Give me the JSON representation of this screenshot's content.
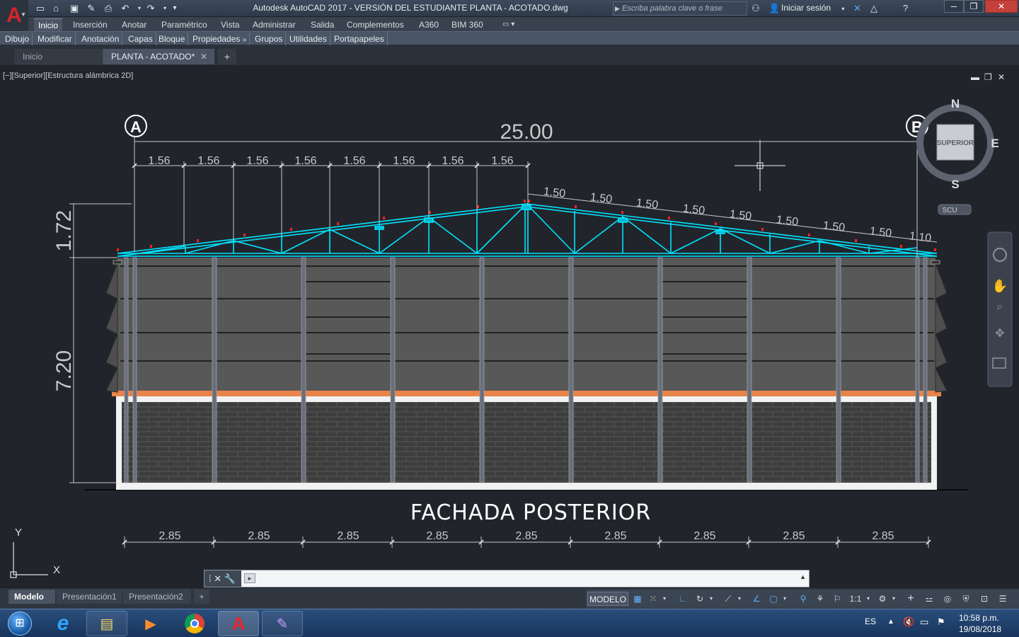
{
  "window": {
    "title": "Autodesk AutoCAD 2017 - VERSIÓN DEL ESTUDIANTE    PLANTA - ACOTADO.dwg",
    "search_placeholder": "Escriba palabra clave o frase",
    "signin_label": "Iniciar sesión"
  },
  "ribbon": {
    "tabs": [
      "Inicio",
      "Inserción",
      "Anotar",
      "Paramétrico",
      "Vista",
      "Administrar",
      "Salida",
      "Complementos",
      "A360",
      "BIM 360"
    ],
    "active_tab": "Inicio",
    "panels": [
      "Dibujo",
      "Modificar",
      "Anotación",
      "Capas",
      "Bloque",
      "Propiedades",
      "Grupos",
      "Utilidades",
      "Portapapeles"
    ]
  },
  "doc_tabs": {
    "start": "Inicio",
    "active": "PLANTA - ACOTADO*"
  },
  "viewport": {
    "label": "[−][Superior][Estructura alámbrica 2D]",
    "viewcube_top": "SUPERIOR",
    "compass": {
      "n": "N",
      "e": "E",
      "s": "S"
    },
    "ucs_label": "SCU",
    "axis_y": "Y",
    "axis_x": "X"
  },
  "drawing": {
    "title": "FACHADA POSTERIOR",
    "grid_a": "A",
    "grid_b": "B",
    "overall_width": "25.00",
    "roof_height": "1.72",
    "wall_height": "7.20",
    "left_slope_dims": [
      "1.56",
      "1.56",
      "1.56",
      "1.56",
      "1.56",
      "1.56",
      "1.56",
      "1.56"
    ],
    "right_slope_dims": [
      "1.50",
      "1.50",
      "1.50",
      "1.50",
      "1.50",
      "1.50",
      "1.50",
      "1.50",
      "1.10"
    ],
    "bay_dims": [
      "2.85",
      "2.85",
      "2.85",
      "2.85",
      "2.85",
      "2.85",
      "2.85",
      "2.85",
      "2.85"
    ],
    "colors": {
      "truss": "#00e5ff",
      "dims": "#c8c8c8",
      "wall": "#595959",
      "brick": "#3a3a3a",
      "base_band": "#e8834a",
      "nodes": "#ff2222"
    }
  },
  "cmdline": {
    "value": ""
  },
  "status": {
    "layout_tabs": [
      "Modelo",
      "Presentación1",
      "Presentación2"
    ],
    "active_layout": "Modelo",
    "model_label": "MODELO",
    "scale": "1:1"
  },
  "taskbar": {
    "language": "ES",
    "time": "10:58 p.m.",
    "date": "19/08/2018"
  }
}
